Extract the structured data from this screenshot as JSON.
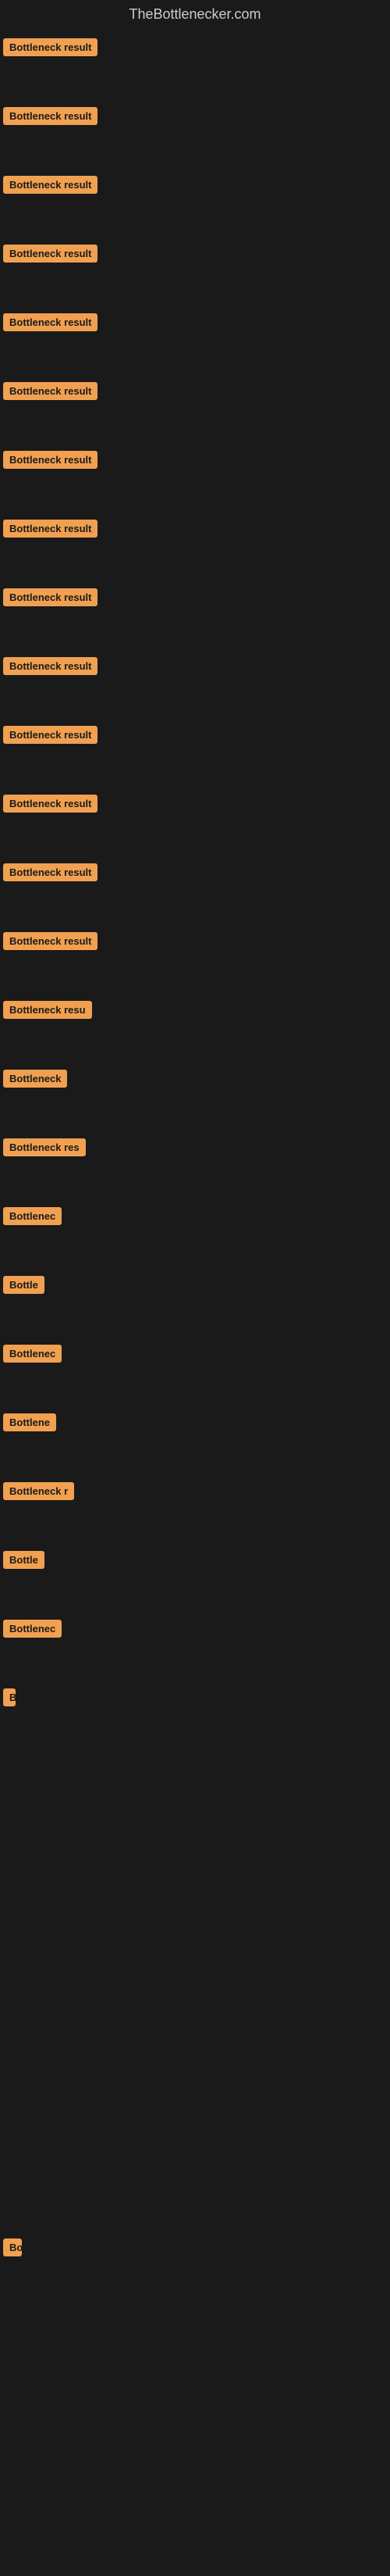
{
  "site": {
    "title": "TheBottlenecker.com"
  },
  "items": [
    {
      "id": 1,
      "label": "Bottleneck result"
    },
    {
      "id": 2,
      "label": "Bottleneck result"
    },
    {
      "id": 3,
      "label": "Bottleneck result"
    },
    {
      "id": 4,
      "label": "Bottleneck result"
    },
    {
      "id": 5,
      "label": "Bottleneck result"
    },
    {
      "id": 6,
      "label": "Bottleneck result"
    },
    {
      "id": 7,
      "label": "Bottleneck result"
    },
    {
      "id": 8,
      "label": "Bottleneck result"
    },
    {
      "id": 9,
      "label": "Bottleneck result"
    },
    {
      "id": 10,
      "label": "Bottleneck result"
    },
    {
      "id": 11,
      "label": "Bottleneck result"
    },
    {
      "id": 12,
      "label": "Bottleneck result"
    },
    {
      "id": 13,
      "label": "Bottleneck result"
    },
    {
      "id": 14,
      "label": "Bottleneck result"
    },
    {
      "id": 15,
      "label": "Bottleneck resu"
    },
    {
      "id": 16,
      "label": "Bottleneck"
    },
    {
      "id": 17,
      "label": "Bottleneck res"
    },
    {
      "id": 18,
      "label": "Bottlenec"
    },
    {
      "id": 19,
      "label": "Bottle"
    },
    {
      "id": 20,
      "label": "Bottlenec"
    },
    {
      "id": 21,
      "label": "Bottlene"
    },
    {
      "id": 22,
      "label": "Bottleneck r"
    },
    {
      "id": 23,
      "label": "Bottle"
    },
    {
      "id": 24,
      "label": "Bottlenec"
    },
    {
      "id": 25,
      "label": "B"
    },
    {
      "id": 26,
      "label": ""
    },
    {
      "id": 27,
      "label": ""
    },
    {
      "id": 28,
      "label": ""
    },
    {
      "id": 29,
      "label": ""
    },
    {
      "id": 30,
      "label": ""
    },
    {
      "id": 31,
      "label": ""
    },
    {
      "id": 32,
      "label": ""
    },
    {
      "id": 33,
      "label": "Bo"
    },
    {
      "id": 34,
      "label": ""
    },
    {
      "id": 35,
      "label": ""
    },
    {
      "id": 36,
      "label": ""
    },
    {
      "id": 37,
      "label": ""
    }
  ]
}
